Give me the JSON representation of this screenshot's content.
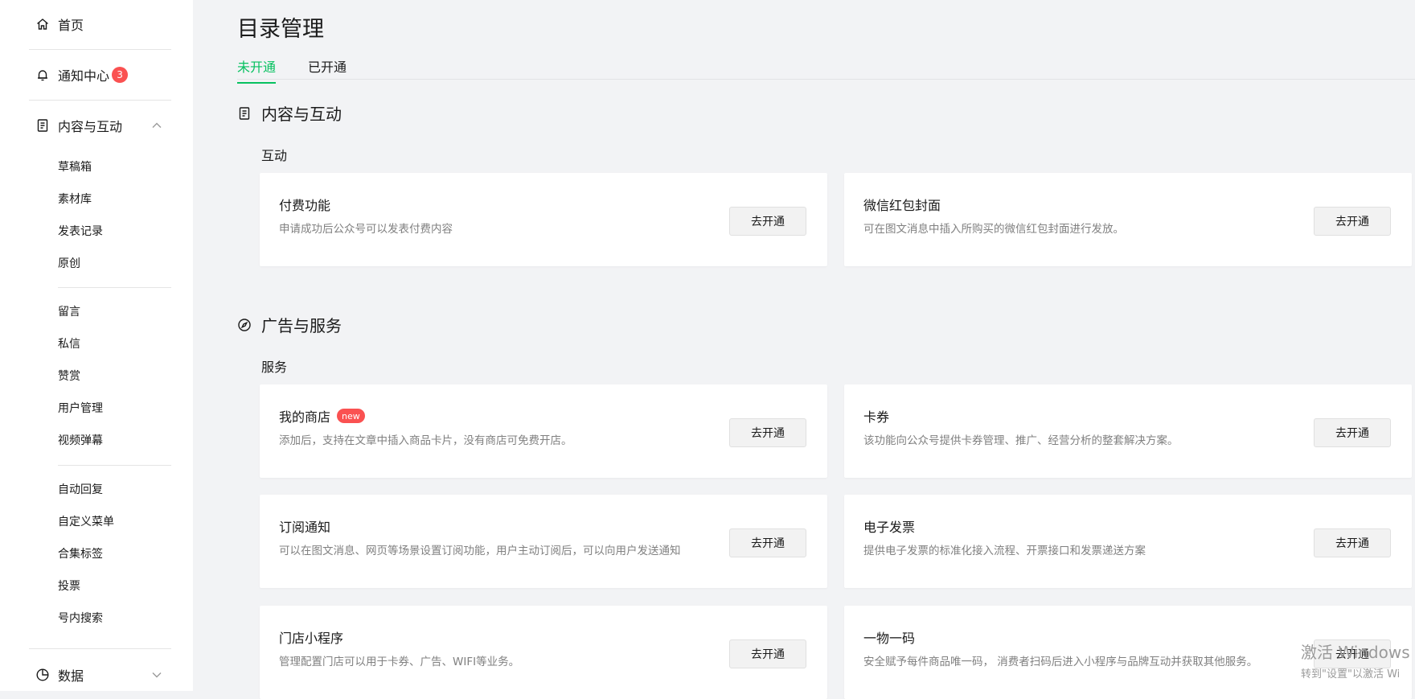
{
  "sidebar": {
    "home": "首页",
    "notifications": {
      "label": "通知中心",
      "count": "3"
    },
    "content": {
      "label": "内容与互动",
      "items_a": [
        "草稿箱",
        "素材库",
        "发表记录",
        "原创"
      ],
      "items_b": [
        "留言",
        "私信",
        "赞赏",
        "用户管理",
        "视频弹幕"
      ],
      "items_c": [
        "自动回复",
        "自定义菜单",
        "合集标签",
        "投票",
        "号内搜索"
      ]
    },
    "data": {
      "label": "数据"
    }
  },
  "main": {
    "title": "目录管理",
    "tabs": [
      {
        "label": "未开通",
        "active": true
      },
      {
        "label": "已开通",
        "active": false
      }
    ],
    "sections": [
      {
        "title": "内容与互动",
        "group": "互动",
        "cards": [
          {
            "name": "付费功能",
            "desc": "申请成功后公众号可以发表付费内容",
            "button": "去开通"
          },
          {
            "name": "微信红包封面",
            "desc": "可在图文消息中插入所购买的微信红包封面进行发放。",
            "button": "去开通"
          }
        ]
      },
      {
        "title": "广告与服务",
        "group": "服务",
        "cards": [
          {
            "name": "我的商店",
            "badge": "new",
            "desc": "添加后，支持在文章中插入商品卡片，没有商店可免费开店。",
            "button": "去开通"
          },
          {
            "name": "卡券",
            "desc": "该功能向公众号提供卡券管理、推广、经营分析的整套解决方案。",
            "button": "去开通"
          },
          {
            "name": "订阅通知",
            "desc": "可以在图文消息、网页等场景设置订阅功能，用户主动订阅后，可以向用户发送通知",
            "button": "去开通"
          },
          {
            "name": "电子发票",
            "desc": "提供电子发票的标准化接入流程、开票接口和发票递送方案",
            "button": "去开通"
          },
          {
            "name": "门店小程序",
            "desc": "管理配置门店可以用于卡券、广告、WIFI等业务。",
            "button": "去开通"
          },
          {
            "name": "一物一码",
            "desc": "安全赋予每件商品唯一码， 消费者扫码后进入小程序与品牌互动并获取其他服务。",
            "button": "去开通"
          }
        ]
      }
    ]
  },
  "watermark": {
    "line1": "激活 Windows",
    "line2": "转到\"设置\"以激活 Wi"
  },
  "colors": {
    "accent": "#07c160",
    "badge": "#fa5151"
  }
}
